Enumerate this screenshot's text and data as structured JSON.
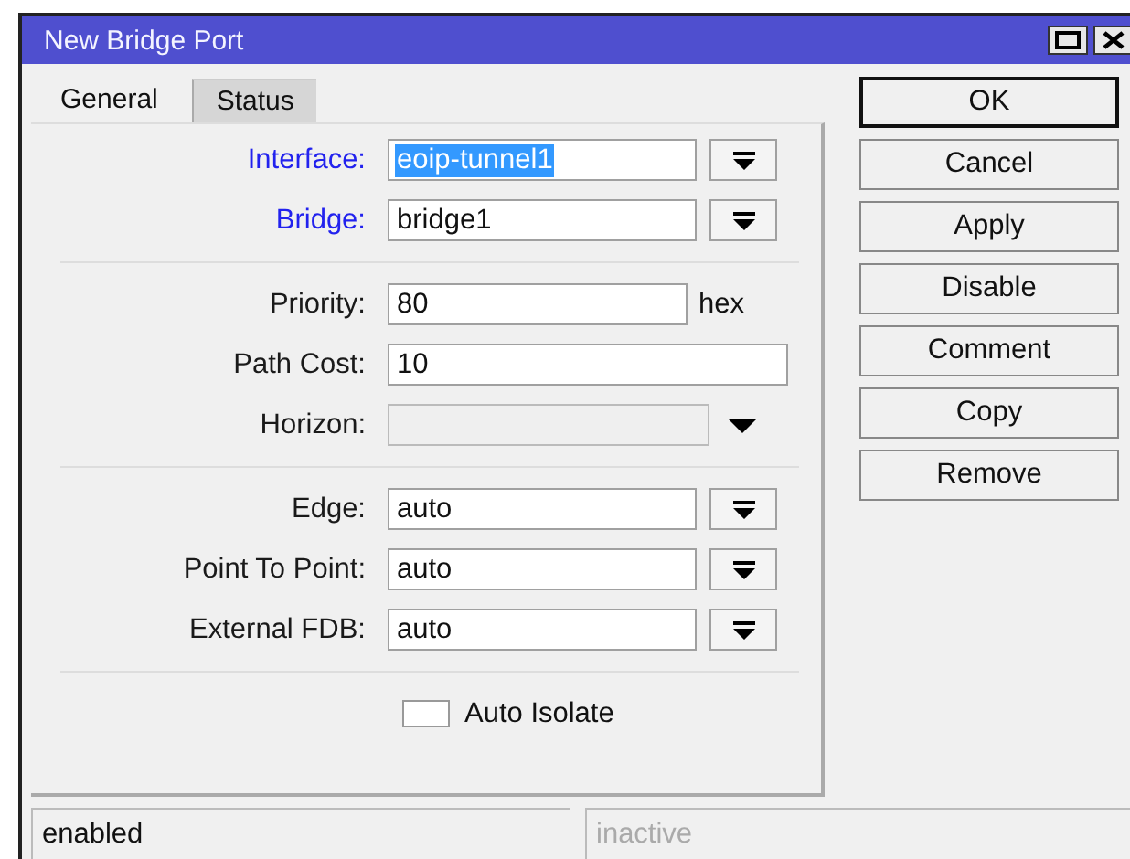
{
  "window": {
    "title": "New Bridge Port"
  },
  "tabs": [
    {
      "label": "General",
      "selected": true
    },
    {
      "label": "Status",
      "selected": false
    }
  ],
  "sections": [
    {
      "items": [
        {
          "kind": "select",
          "label": "Interface:",
          "value": "eoip-tunnel1",
          "required": true,
          "focused": true
        },
        {
          "kind": "select",
          "label": "Bridge:",
          "value": "bridge1",
          "required": true,
          "focused": false
        }
      ]
    },
    {
      "items": [
        {
          "kind": "unit",
          "label": "Priority:",
          "value": "80",
          "unit": "hex",
          "required": false,
          "focused": false
        },
        {
          "kind": "text",
          "label": "Path Cost:",
          "value": "10",
          "required": false,
          "focused": false
        },
        {
          "kind": "disabled",
          "label": "Horizon:",
          "required": false,
          "focused": false
        }
      ]
    },
    {
      "items": [
        {
          "kind": "select",
          "label": "Edge:",
          "value": "auto",
          "required": false,
          "focused": false
        },
        {
          "kind": "select",
          "label": "Point To Point:",
          "value": "auto",
          "required": false,
          "focused": false
        },
        {
          "kind": "select",
          "label": "External FDB:",
          "value": "auto",
          "required": false,
          "focused": false
        }
      ]
    },
    {
      "items": [
        {
          "kind": "checkbox",
          "label": "Auto Isolate",
          "checked": false
        }
      ]
    }
  ],
  "buttons": [
    {
      "label": "OK",
      "default": true
    },
    {
      "label": "Cancel",
      "default": false
    },
    {
      "label": "Apply",
      "default": false
    },
    {
      "label": "Disable",
      "default": false
    },
    {
      "label": "Comment",
      "default": false
    },
    {
      "label": "Copy",
      "default": false
    },
    {
      "label": "Remove",
      "default": false
    }
  ],
  "status_bar": [
    {
      "text": "enabled",
      "dimmed": false
    },
    {
      "text": "inactive",
      "dimmed": true
    }
  ]
}
